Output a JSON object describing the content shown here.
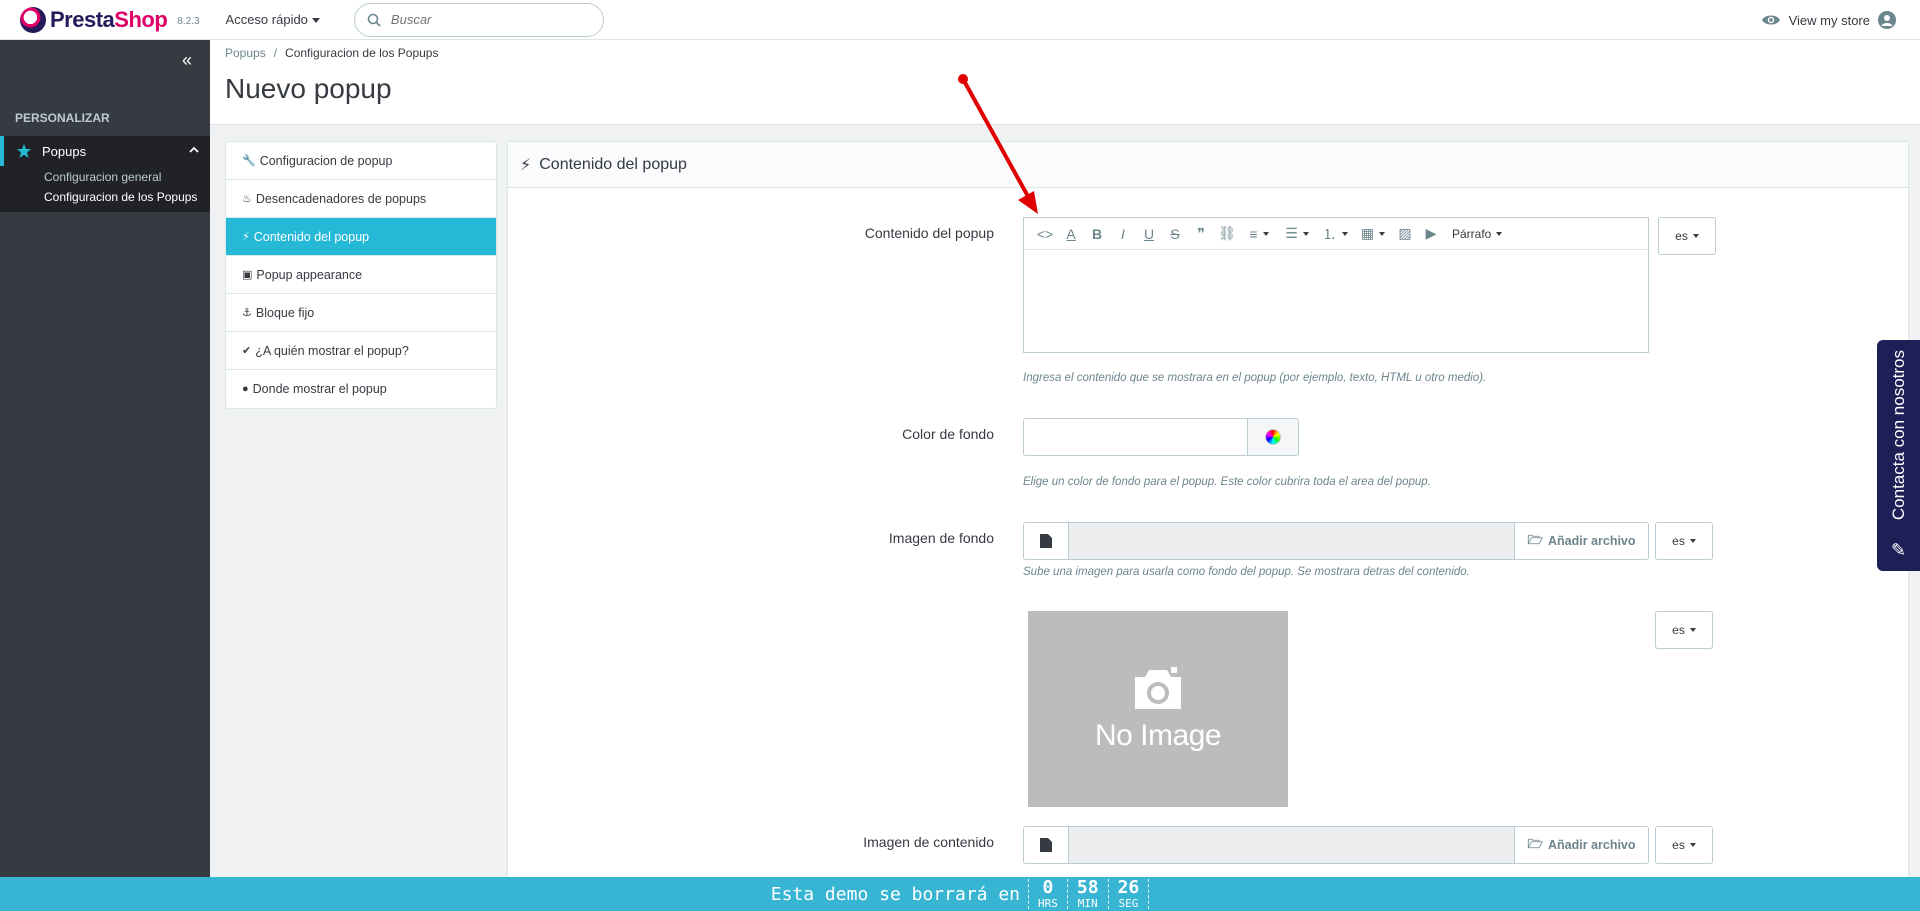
{
  "header": {
    "logo_presta": "Presta",
    "logo_shop": "Shop",
    "version": "8.2.3",
    "quick_access": "Acceso rápido",
    "search_placeholder": "Buscar",
    "view_store": "View my store"
  },
  "sidebar": {
    "section": "PERSONALIZAR",
    "active_item": "Popups",
    "sub_items": [
      "Configuracion general",
      "Configuracion de los Popups"
    ]
  },
  "breadcrumb": {
    "parent": "Popups",
    "separator": "/",
    "current": "Configuracion de los Popups"
  },
  "page_title": "Nuevo popup",
  "tabs": [
    {
      "label": "Configuracion de popup",
      "icon": "wrench-icon",
      "active": false
    },
    {
      "label": "Desencadenadores de popups",
      "icon": "fire-icon",
      "active": false
    },
    {
      "label": "Contenido del popup",
      "icon": "magic-wand-icon",
      "active": true
    },
    {
      "label": "Popup appearance",
      "icon": "picture-icon",
      "active": false
    },
    {
      "label": "Bloque fijo",
      "icon": "anchor-icon",
      "active": false
    },
    {
      "label": "¿A quién mostrar el popup?",
      "icon": "check-icon",
      "active": false
    },
    {
      "label": "Donde mostrar el popup",
      "icon": "globe-icon",
      "active": false
    }
  ],
  "panel": {
    "title": "Contenido del popup",
    "fields": {
      "content": {
        "label": "Contenido del popup",
        "help": "Ingresa el contenido que se mostrara en el popup (por ejemplo, texto, HTML u otro medio).",
        "format": "Párrafo",
        "lang": "es"
      },
      "bg_color": {
        "label": "Color de fondo",
        "help": "Elige un color de fondo para el popup. Este color cubrira toda el area del popup."
      },
      "bg_image": {
        "label": "Imagen de fondo",
        "button": "Añadir archivo",
        "help": "Sube una imagen para usarla como fondo del popup. Se mostrara detras del contenido.",
        "lang": "es",
        "preview_lang": "es",
        "preview_text": "No Image"
      },
      "content_image": {
        "label": "Imagen de contenido",
        "button": "Añadir archivo",
        "lang": "es"
      }
    }
  },
  "contact_tab": "Contacta con nosotros",
  "demo_bar": {
    "text": "Esta demo se borrará en",
    "hours": "0",
    "hours_unit": "HRS",
    "minutes": "58",
    "minutes_unit": "MIN",
    "seconds": "26",
    "seconds_unit": "SEG"
  },
  "colors": {
    "accent": "#25b9d7",
    "sidebar": "#363a41",
    "demo_bar": "#37b5d3",
    "contact": "#1f1f57",
    "annotation": "#e00000"
  }
}
